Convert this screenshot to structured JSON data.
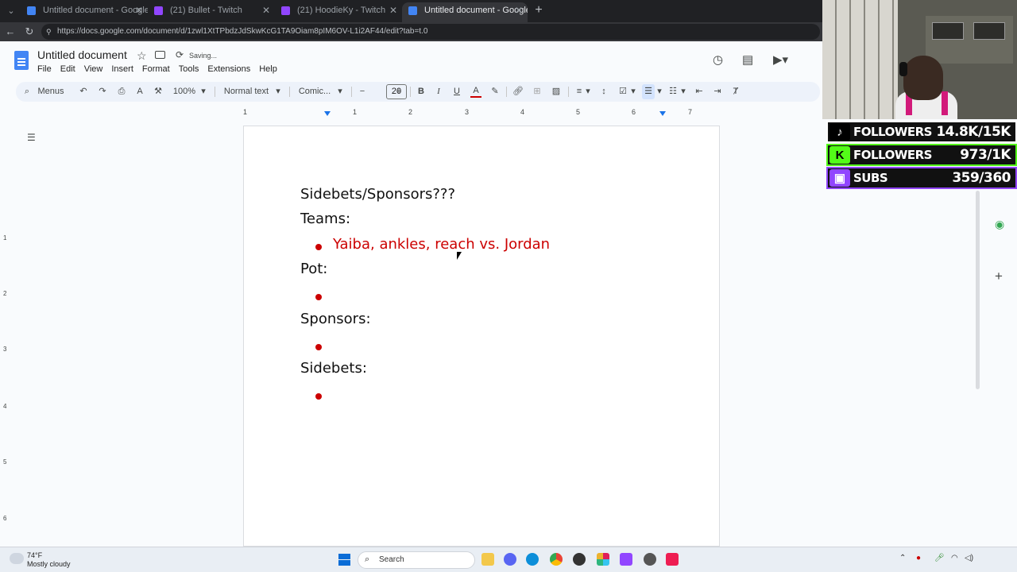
{
  "browser": {
    "tabs": [
      {
        "title": "Untitled document - Google Docs",
        "favicon": "google-docs-icon",
        "active": false
      },
      {
        "title": "(21) Bullet - Twitch",
        "favicon": "twitch-icon",
        "active": false
      },
      {
        "title": "(21) HoodieKy - Twitch",
        "favicon": "twitch-icon",
        "active": false
      },
      {
        "title": "Untitled document - Google Docs",
        "favicon": "google-docs-icon",
        "active": true
      }
    ],
    "url": "https://docs.google.com/document/d/1zwl1XtTPbdzJdSkwKcG1TA9Oiam8pIM6OV-L1i2AF44/edit?tab=t.0"
  },
  "docs": {
    "title": "Untitled document",
    "status": "Saving...",
    "menu": [
      "File",
      "Edit",
      "View",
      "Insert",
      "Format",
      "Tools",
      "Extensions",
      "Help"
    ],
    "toolbar": {
      "menus_label": "Menus",
      "zoom": "100%",
      "style": "Normal text",
      "font": "Comic...",
      "font_size": "20"
    }
  },
  "ruler": {
    "numbers": [
      "1",
      "1",
      "2",
      "3",
      "4",
      "5",
      "6",
      "7"
    ]
  },
  "vruler": {
    "numbers": [
      "1",
      "2",
      "3",
      "4",
      "5",
      "6"
    ]
  },
  "document": {
    "heading": "Sidebets/Sponsors???",
    "teams_label": " Teams:",
    "teams_bullet": "Yaiba, ankles, reach vs. Jordan",
    "pot_label": "Pot:",
    "sponsors_label": "Sponsors:",
    "sidebets_label": "Sidebets:",
    "bullet_color": "#cc0000"
  },
  "overlay": {
    "tiktok": {
      "label": "FOLLOWERS",
      "value": "14.8K/15K"
    },
    "kick": {
      "label": "FOLLOWERS",
      "value": "973/1K"
    },
    "twitch": {
      "label": "SUBS",
      "value": "359/360"
    }
  },
  "taskbar": {
    "weather_temp": "74°F",
    "weather_desc": "Mostly cloudy",
    "search_label": "Search"
  }
}
